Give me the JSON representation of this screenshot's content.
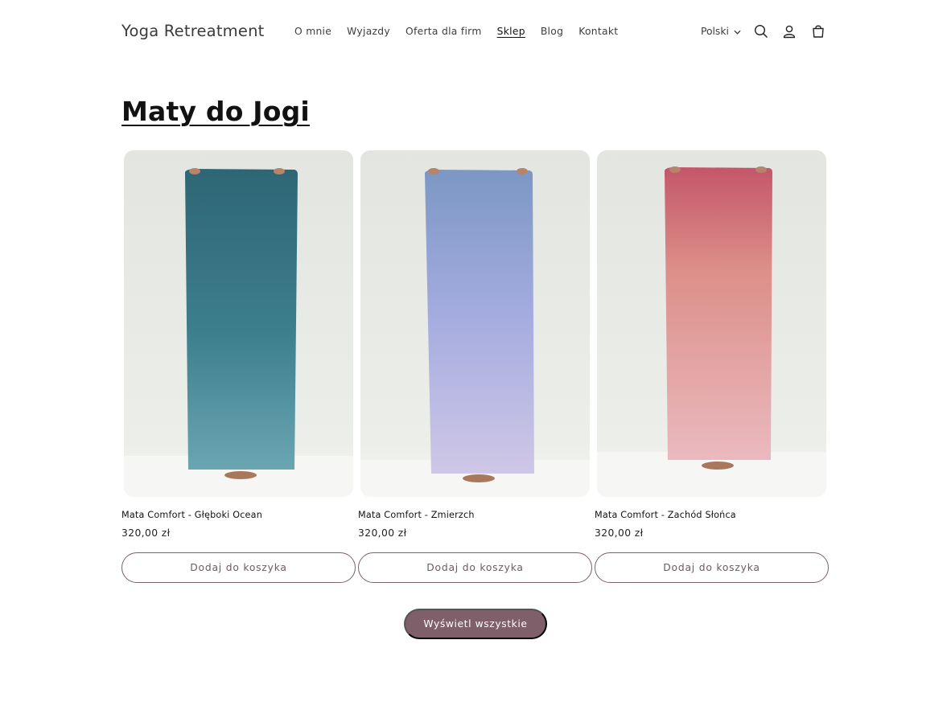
{
  "header": {
    "logo": "Yoga Retreatment",
    "nav": [
      {
        "label": "O mnie",
        "active": false
      },
      {
        "label": "Wyjazdy",
        "active": false
      },
      {
        "label": "Oferta dla firm",
        "active": false
      },
      {
        "label": "Sklep",
        "active": true
      },
      {
        "label": "Blog",
        "active": false
      },
      {
        "label": "Kontakt",
        "active": false
      }
    ],
    "language": "Polski",
    "icons": [
      "chevron-down-icon",
      "search-icon",
      "account-icon",
      "cart-icon"
    ]
  },
  "collection": {
    "title": "Maty do Jogi",
    "products": [
      {
        "name": "Mata Comfort - Głęboki Ocean",
        "price": "320,00 zł",
        "button": "Dodaj do koszyka",
        "colors": {
          "top": "#2e6675",
          "bottom": "#6aa6b2"
        }
      },
      {
        "name": "Mata Comfort - Zmierzch",
        "price": "320,00 zł",
        "button": "Dodaj do koszyka",
        "colors": {
          "top": "#7c97c4",
          "bottom": "#cfc7e6"
        }
      },
      {
        "name": "Mata Comfort - Zachód Słońca",
        "price": "320,00 zł",
        "button": "Dodaj do koszyka",
        "colors": {
          "top": "#c4566a",
          "bottom": "#eab9bf"
        }
      }
    ],
    "view_all": "Wyświetl wszystkie"
  },
  "theme": {
    "accent": "#7e5f6a",
    "text": "#121212",
    "photo_background": "#e8e9e5"
  }
}
